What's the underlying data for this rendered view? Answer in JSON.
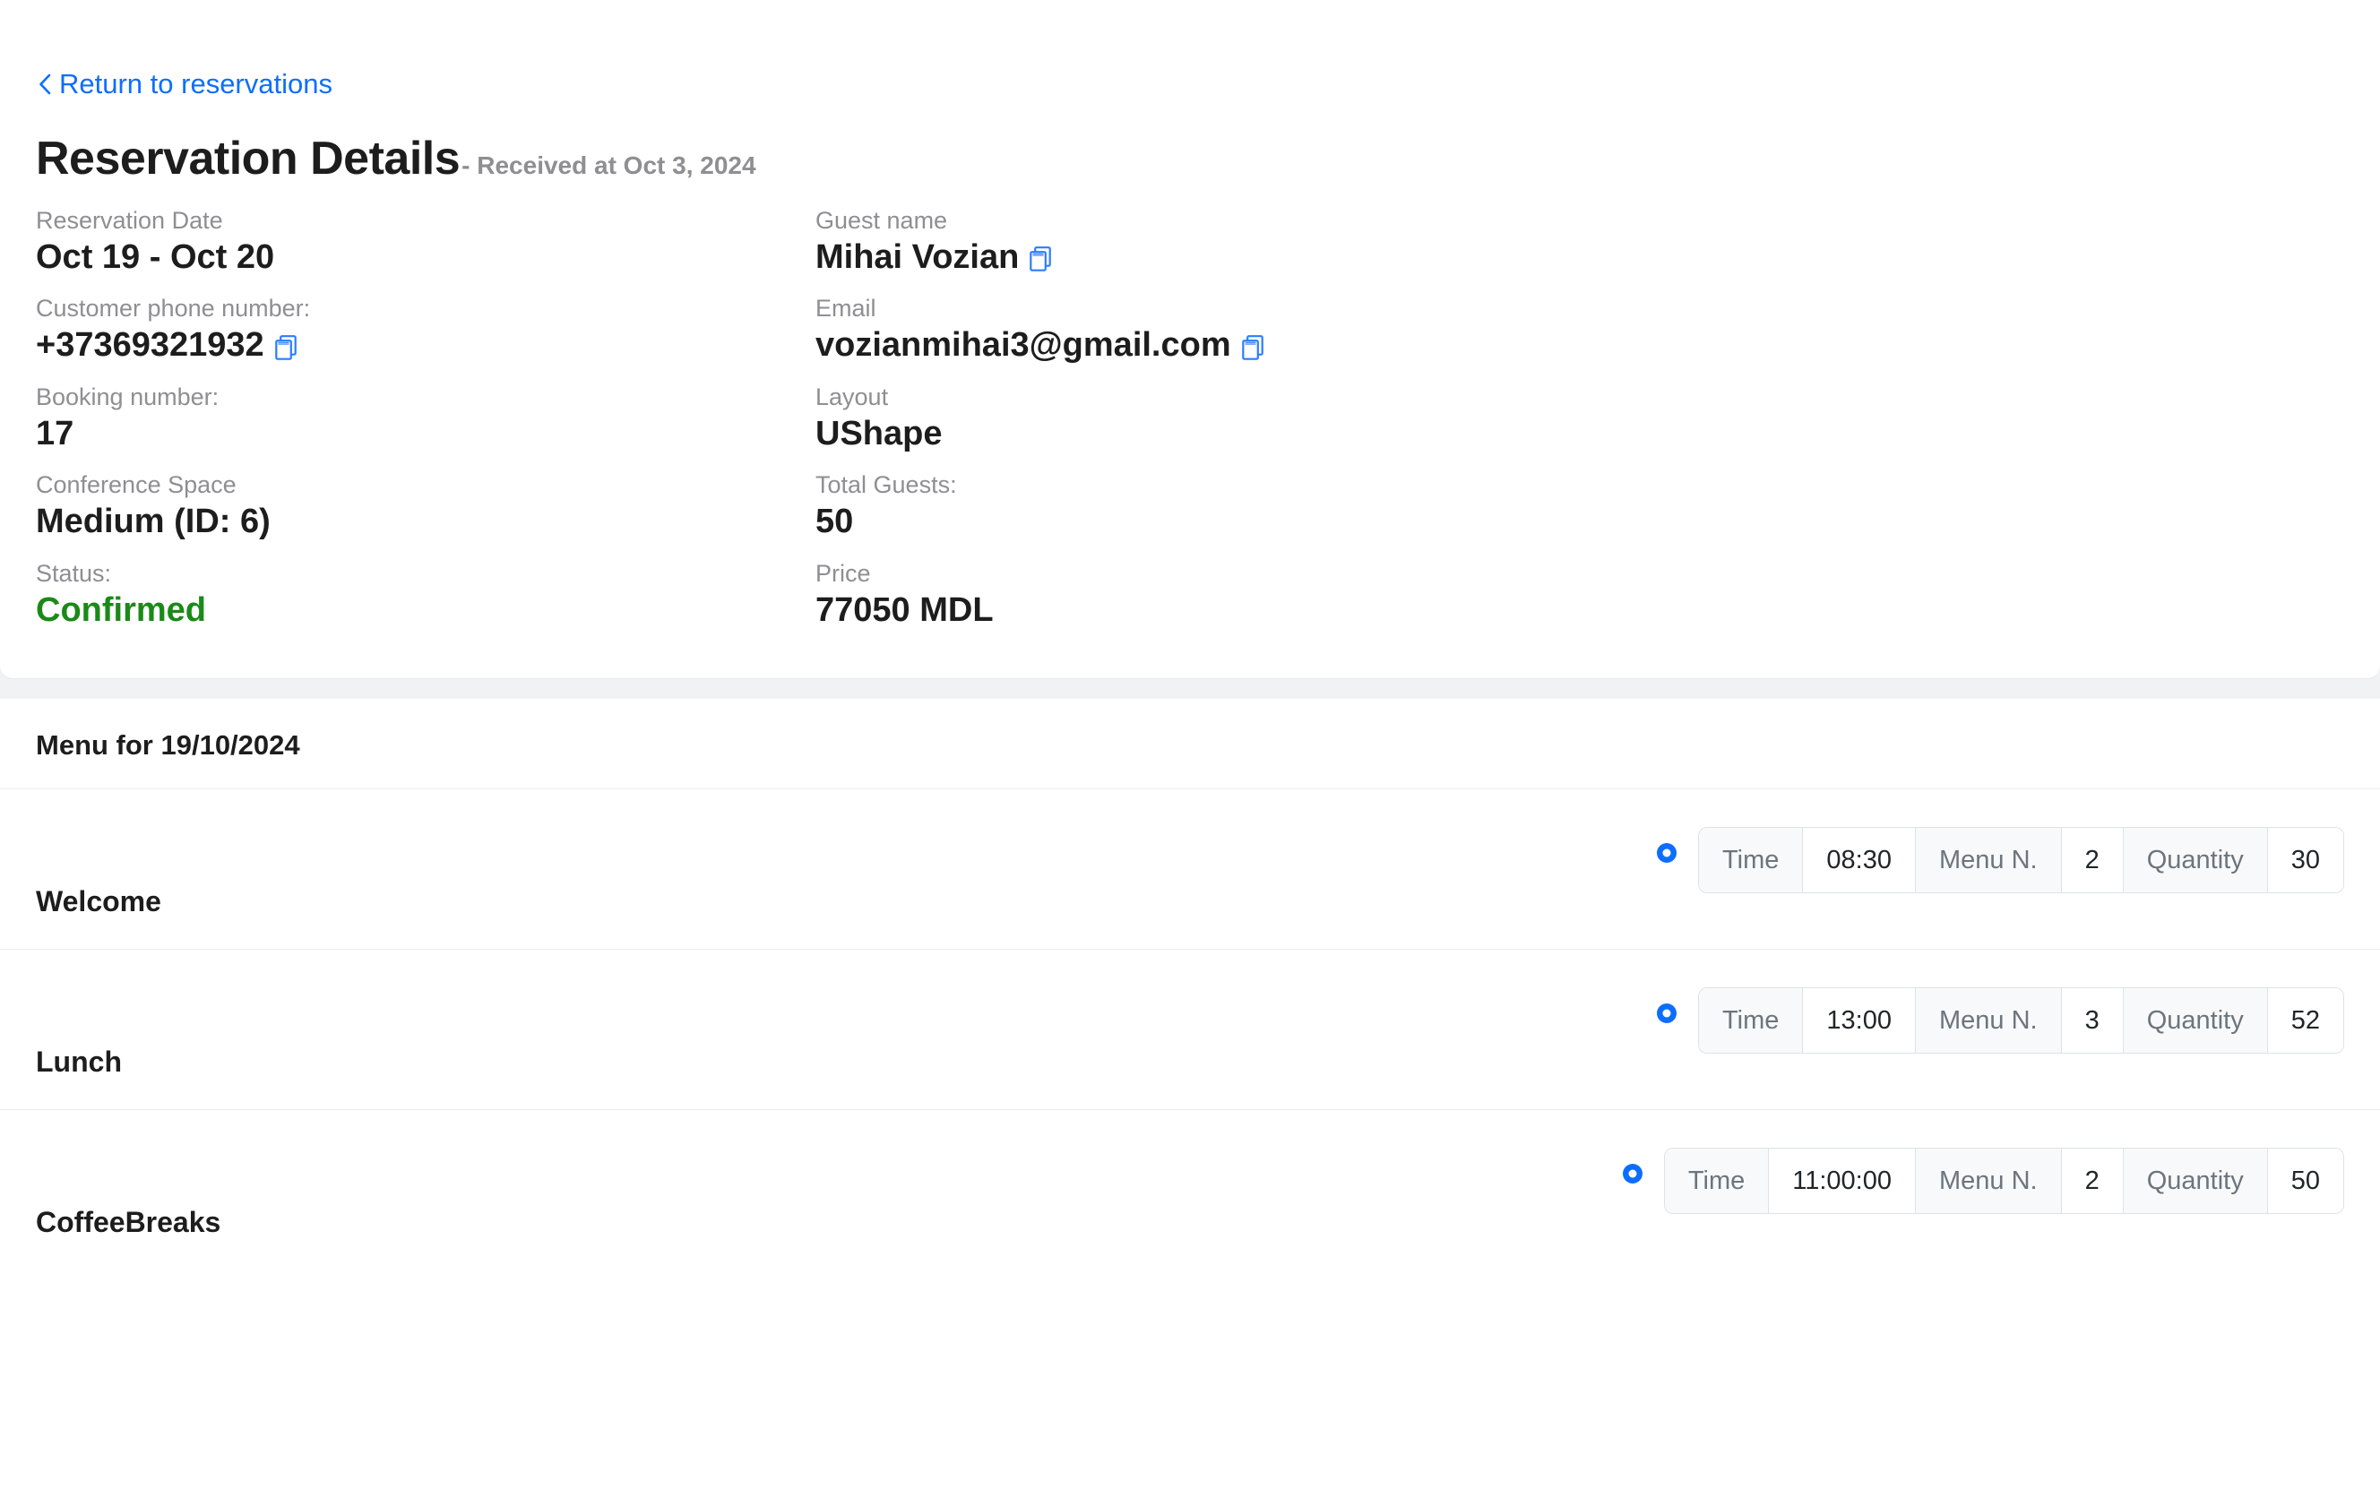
{
  "nav": {
    "back_label": "Return to reservations",
    "back_icon": "chevron-left-icon"
  },
  "header": {
    "title": "Reservation Details",
    "received_text": "- Received at Oct 3, 2024"
  },
  "details": {
    "left": [
      {
        "label": "Reservation Date",
        "value": "Oct 19 - Oct 20",
        "copy": false
      },
      {
        "label": "Customer phone number:",
        "value": "+37369321932",
        "copy": true
      },
      {
        "label": "Booking number:",
        "value": "17",
        "copy": false
      },
      {
        "label": "Conference Space",
        "value": "Medium (ID: 6)",
        "copy": false
      },
      {
        "label": "Status:",
        "value": "Confirmed",
        "copy": false,
        "status": true
      }
    ],
    "right": [
      {
        "label": "Guest name",
        "value": "Mihai Vozian",
        "copy": true
      },
      {
        "label": "Email",
        "value": "vozianmihai3@gmail.com",
        "copy": true
      },
      {
        "label": "Layout",
        "value": "UShape",
        "copy": false
      },
      {
        "label": "Total Guests:",
        "value": "50",
        "copy": false
      },
      {
        "label": "Price",
        "value": "77050 MDL",
        "copy": false
      }
    ]
  },
  "menu": {
    "heading": "Menu for 19/10/2024",
    "labels": {
      "time": "Time",
      "menu_number": "Menu N.",
      "quantity": "Quantity"
    },
    "rows": [
      {
        "name": "Welcome",
        "time": "08:30",
        "menu_number": "2",
        "quantity": "30"
      },
      {
        "name": "Lunch",
        "time": "13:00",
        "menu_number": "3",
        "quantity": "52"
      },
      {
        "name": "CoffeeBreaks",
        "time": "11:00:00",
        "menu_number": "2",
        "quantity": "50"
      }
    ]
  },
  "colors": {
    "link": "#0d6efd",
    "status_confirmed": "#1a8a17",
    "muted": "#8e8e93",
    "band": "#f1f2f3"
  }
}
